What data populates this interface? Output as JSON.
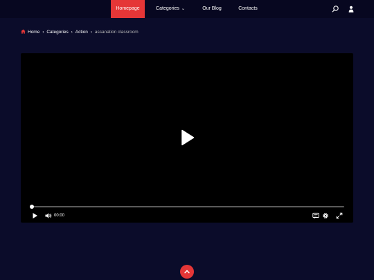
{
  "nav": {
    "items": [
      {
        "label": "Homepage",
        "active": true
      },
      {
        "label": "Categories",
        "has_dropdown": true
      },
      {
        "label": "Our Blog"
      },
      {
        "label": "Contacts"
      }
    ],
    "icons": [
      "search-icon",
      "user-icon"
    ]
  },
  "breadcrumb": {
    "items": [
      "Home",
      "Categories",
      "Action"
    ],
    "current": "assanation classroom"
  },
  "player": {
    "time": "00:00",
    "progress": 0
  },
  "colors": {
    "accent": "#e53637",
    "background": "#0b0c2a",
    "header": "#070720"
  }
}
